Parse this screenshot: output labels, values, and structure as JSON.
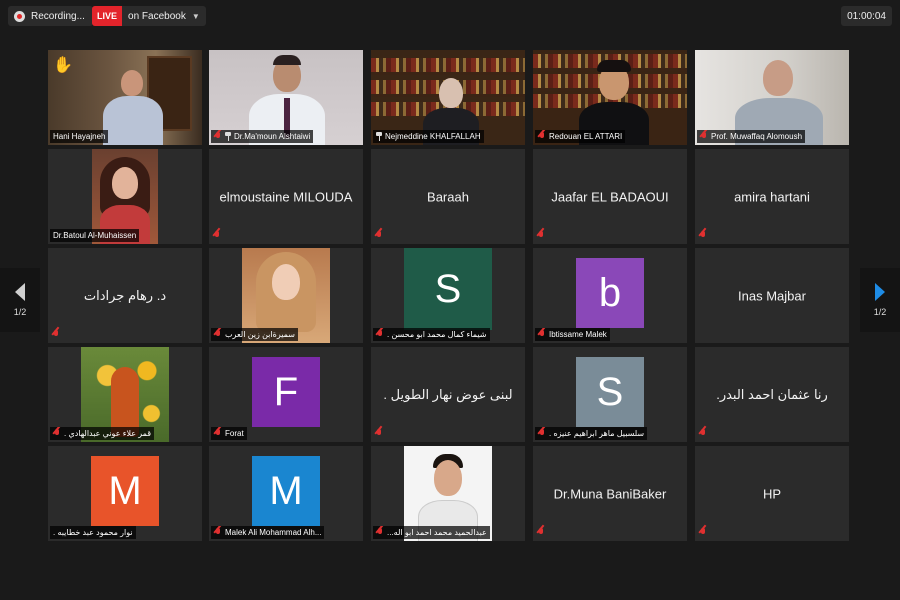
{
  "topbar": {
    "recording_label": "Recording...",
    "live_badge": "LIVE",
    "live_target": "on Facebook",
    "timer": "01:00:04"
  },
  "nav": {
    "page_indicator": "1/2"
  },
  "colors": {
    "active_speaker": "#b6d96a",
    "live": "#e3242b",
    "next_arrow": "#1e8ce6"
  },
  "tiles": {
    "t1": {
      "name": "Hani Hayajneh"
    },
    "t2": {
      "name": "Dr.Ma'moun Alshtaiwi"
    },
    "t3": {
      "name": "Nejmeddine KHALFALLAH"
    },
    "t4": {
      "name": "Redouan EL ATTARI"
    },
    "t5": {
      "name": "Prof. Muwaffaq Alomoush"
    },
    "t6": {
      "name": "Dr.Batoul Al-Muhaissen"
    },
    "t7": {
      "display": "elmoustaine MILOUDA"
    },
    "t8": {
      "display": "Baraah"
    },
    "t9": {
      "display": "Jaafar EL BADAOUI"
    },
    "t10": {
      "display": "amira hartani"
    },
    "t11": {
      "display": "د. رهام جرادات"
    },
    "t12": {
      "name": "سميرةابن زين العرب"
    },
    "t13": {
      "initial": "S",
      "name": "شيماء كمال محمد ابو محسن ."
    },
    "t14": {
      "initial": "b",
      "name": "Ibtissame Malek"
    },
    "t15": {
      "display": "Inas Majbar"
    },
    "t16": {
      "name": "قمر علاء عوني عبدالهادي ."
    },
    "t17": {
      "initial": "F",
      "name": "Forat"
    },
    "t18": {
      "display": "لبنى عوض نهار الطويل ."
    },
    "t19": {
      "initial": "S",
      "name": "سلسبيل ماهر ابراهيم عنيزه ."
    },
    "t20": {
      "display": "رنا عثمان احمد البدر."
    },
    "t21": {
      "initial": "M",
      "name": "نوار محمود عبد خطايبه ."
    },
    "t22": {
      "initial": "M",
      "name": "Malek Ali Mohammad Alh..."
    },
    "t23": {
      "name": "عبدالحميد محمد احمد ابو اله..."
    },
    "t24": {
      "display": "Dr.Muna BaniBaker"
    },
    "t25": {
      "display": "HP"
    }
  },
  "icons": {
    "hand": "raised-hand-icon",
    "mic": "mic-muted-icon",
    "pin": "pin-icon",
    "record": "record-icon",
    "nav_prev": "chevron-left-icon",
    "nav_next": "chevron-right-icon"
  }
}
